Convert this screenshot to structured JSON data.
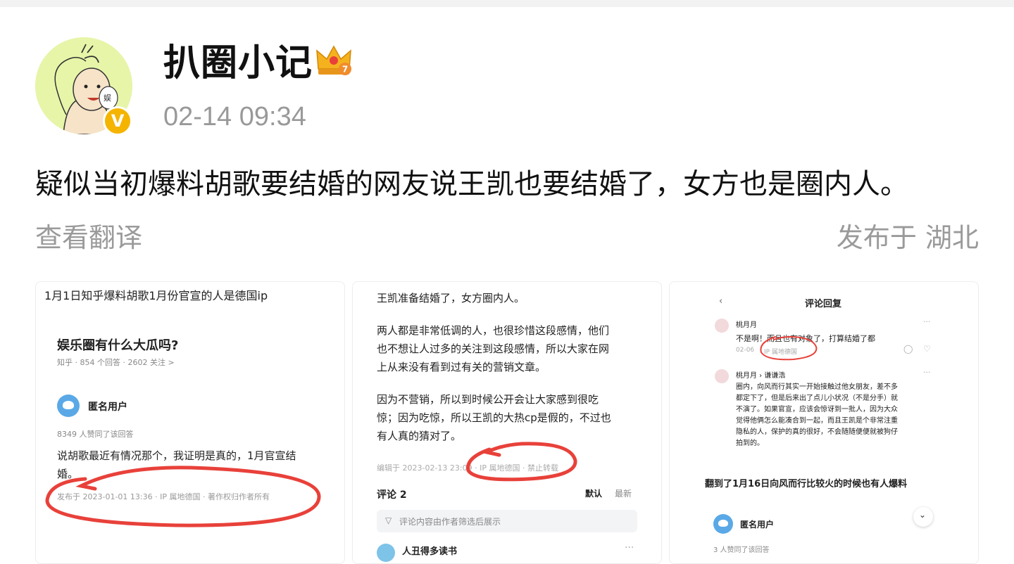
{
  "post": {
    "author": "扒圈小记",
    "timestamp": "02-14 09:34",
    "text": "疑似当初爆料胡歌要结婚的网友说王凯也要结婚了，女方也是圈内人。",
    "translate_label": "查看翻译",
    "location_label": "发布于 湖北",
    "badge_letter": "V",
    "badge_color": "#f4b400",
    "avatar_bubble_text": "娱"
  },
  "image1": {
    "caption": "1月1日知乎爆料胡歌1月份官宣的人是德国ip",
    "question_title": "娱乐圈有什么大瓜吗?",
    "question_meta": "知乎 · 854 个回答 · 2602 关注 >",
    "user_name": "匿名用户",
    "likes": "8349 人赞同了该回答",
    "answer_text_line1": "说胡歌最近有情况那个，我证明是真的，1月官宣结",
    "answer_text_line2": "婚。",
    "publish_info": "发布于 2023-01-01 13:36 · IP 属地德国 · 著作权归作者所有"
  },
  "image2": {
    "line1": "王凯准备结婚了，女方圈内人。",
    "para1": [
      "两人都是非常低调的人，也很珍惜这段感情，他们",
      "也不想让人过多的关注到这段感情，所以大家在网",
      "上从来没有看到过有关的营销文章。"
    ],
    "para2": [
      "因为不营销，所以到时候公开会让大家感到很吃",
      "惊；因为吃惊，所以王凯的大热cp是假的，不过也",
      "有人真的猜对了。"
    ],
    "edit_info": "编辑于 2023-02-13 23:09 · IP 属地德国 · 禁止转载",
    "comments_label": "评论 2",
    "sort_default": "默认",
    "sort_latest": "最新",
    "filter_note": "评论内容由作者筛选后展示",
    "commenter": "人丑得多读书"
  },
  "image3": {
    "header_title": "评论回复",
    "c1_name": "桃月月",
    "c1_text": "不是啊！而且也有对象了，打算结婚了都",
    "c1_meta_date": "02-06",
    "c1_meta_ip": "IP 属地德国",
    "c2_name": "桃月月 › 谦谦浩",
    "c2_lines": [
      "圈内，向风而行其实一开始接触过他女朋友，差不多",
      "都定下了，但是后来出了点儿小状况（不是分手）就",
      "不演了。如果官宣，应该会惊讶到一批人，因为大众",
      "觉得他俩怎么能凑合到一起，而且王凯是个非常注重",
      "隐私的人，保护的真的很好，不会随随便便就被狗仔",
      "拍到的。"
    ],
    "caption": "翻到了1月16日向风而行比较火的时候也有人爆料",
    "user_name": "匿名用户",
    "likes": "3 人赞同了该回答"
  },
  "colors": {
    "pen": "#e8413a",
    "accent_gold": "#f4b400",
    "muted_text": "#999999"
  }
}
